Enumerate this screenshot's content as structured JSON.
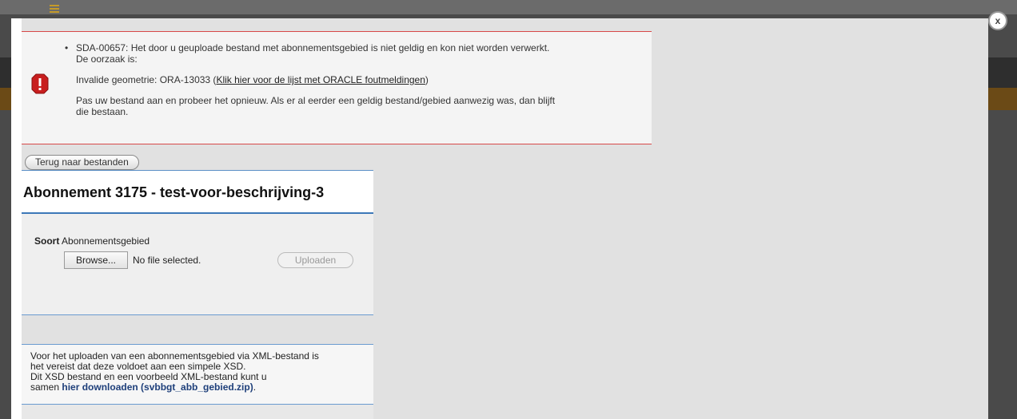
{
  "error": {
    "line1": "SDA-00657: Het door u geuploade bestand met abonnementsgebied is niet geldig en kon niet worden verwerkt.",
    "line2": "De oorzaak is:",
    "geometry_prefix": "Invalide geometrie: ORA-13033 (",
    "geometry_link": "Klik hier voor de lijst met ORACLE foutmeldingen",
    "geometry_suffix": ")",
    "advice_line1": "Pas uw bestand aan en probeer het opnieuw. Als er al eerder een geldig bestand/gebied aanwezig was, dan blijft",
    "advice_line2": "die bestaan."
  },
  "back_button_label": "Terug naar bestanden",
  "subscription_title": "Abonnement 3175 - test-voor-beschrijving-3",
  "upload": {
    "soort_label": "Soort",
    "soort_value": "Abonnementsgebied",
    "browse_label": "Browse...",
    "file_status": "No file selected.",
    "upload_label": "Uploaden"
  },
  "info": {
    "line1": "Voor het uploaden van een abonnementsgebied via XML-bestand is",
    "line2": "het vereist dat deze voldoet aan een simpele XSD.",
    "line3": "Dit XSD bestand en een voorbeeld XML-bestand kunt u",
    "line4_prefix": "samen ",
    "download_link": "hier downloaden (svbbgt_abb_gebied.zip)",
    "line4_suffix": "."
  },
  "close_label": "x",
  "colors": {
    "error_border": "#d84848",
    "accent_blue": "#3d78b8",
    "link_blue": "#1e3f7a"
  },
  "icons": {
    "error": "error-exclamation-icon",
    "close": "close-icon"
  }
}
